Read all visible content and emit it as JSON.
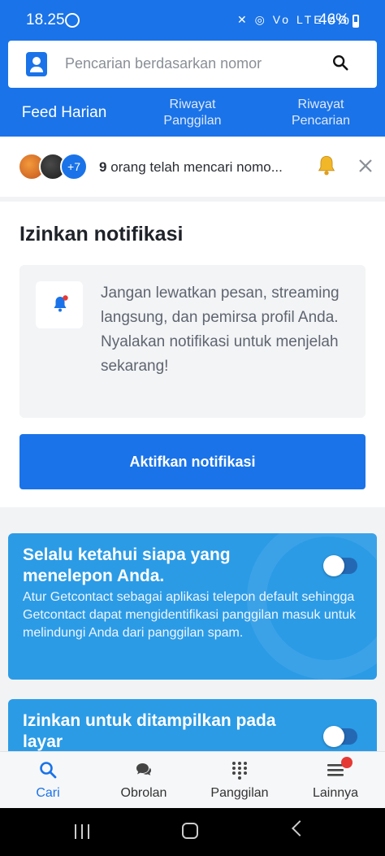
{
  "status_bar": {
    "time": "18.25",
    "network_icons": "✕ ◎ Vo LTE 4G",
    "battery": "46%"
  },
  "search": {
    "placeholder": "Pencarian berdasarkan nomor"
  },
  "tabs": [
    {
      "label": "Feed Harian",
      "active": true
    },
    {
      "label": "Riwayat Panggilan",
      "line1": "Riwayat",
      "line2": "Panggilan",
      "active": false
    },
    {
      "label": "Riwayat Pencarian",
      "line1": "Riwayat",
      "line2": "Pencarian",
      "active": false
    }
  ],
  "searchers": {
    "extra_count": "+7",
    "count": "9",
    "text": " orang telah mencari nomo..."
  },
  "notification": {
    "title": "Izinkan notifikasi",
    "message": "Jangan lewatkan pesan, streaming langsung, dan pemirsa profil Anda. Nyalakan notifikasi untuk menjelah sekarang!",
    "button": "Aktifkan notifikasi"
  },
  "promos": [
    {
      "title": "Selalu ketahui siapa yang menelepon Anda.",
      "description": "Atur Getcontact sebagai aplikasi telepon default sehingga Getcontact dapat mengidentifikasi panggilan masuk untuk melindungi Anda dari panggilan spam.",
      "toggle_on": false
    },
    {
      "title": "Izinkan untuk ditampilkan pada layar",
      "toggle_on": false
    }
  ],
  "bottom_nav": [
    {
      "label": "Cari",
      "icon": "search-icon",
      "active": true
    },
    {
      "label": "Obrolan",
      "icon": "chat-icon",
      "active": false
    },
    {
      "label": "Panggilan",
      "icon": "dialpad-icon",
      "active": false
    },
    {
      "label": "Lainnya",
      "icon": "menu-icon",
      "active": false,
      "badge": true
    }
  ],
  "colors": {
    "primary": "#1a73e8",
    "promo": "#2b9be6",
    "badge": "#e53935"
  }
}
